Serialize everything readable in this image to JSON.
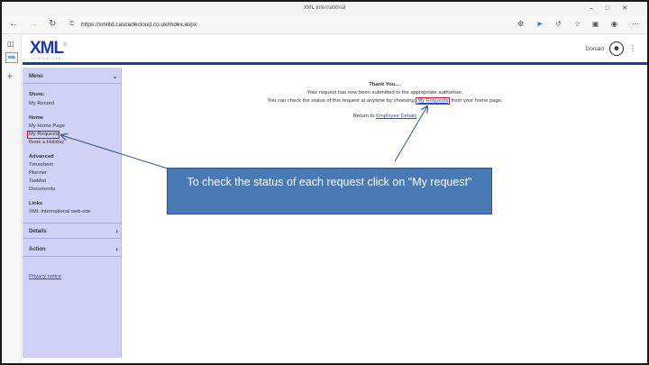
{
  "browser": {
    "window_title": "XML International",
    "url": "https://xmlltd.cascadecloud.co.uk/index.aspx",
    "tab_badge": "XML"
  },
  "header": {
    "logo_text": "XML",
    "logo_superscript": "®",
    "logo_subtext": "International",
    "username": "Donald"
  },
  "sidebar": {
    "menu_label": "Menu",
    "show_label": "Show:",
    "my_record": "My Record",
    "home_label": "Home",
    "my_home_page": "My Home Page",
    "my_requests": "My Requests",
    "book_holiday": "Book a Holiday",
    "advanced_label": "Advanced",
    "timesheet": "Timesheet",
    "planner": "Planner",
    "tasklist": "Tasklist",
    "documents": "Documents",
    "links_label": "Links",
    "xml_website": "XML International web-site",
    "details_label": "Details",
    "action_label": "Action",
    "privacy_notice": "Privacy notice"
  },
  "main": {
    "thank_you": "Thank You....",
    "line1": "Your request has now been submitted to the appropriate authoriser.",
    "line2_pre": "You can check the status of this request at anytime by choosing ",
    "line2_link": "My Requests",
    "line2_post": " from your home page.",
    "return_pre": "Return to ",
    "return_link": "Employee Details"
  },
  "callout": {
    "text": "To check the status of each request click on \"My request\""
  },
  "colors": {
    "brand_blue": "#1d3aa0",
    "sidebar_bg": "#d1d1f7",
    "callout_bg": "#4a7ab3",
    "highlight_red": "#d0161a",
    "link_blue": "#2b4bd1"
  }
}
